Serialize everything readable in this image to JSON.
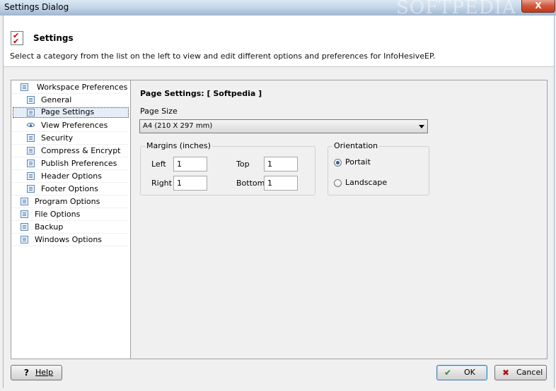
{
  "window": {
    "title": "Settings Dialog",
    "watermark": "SOFTPEDIA",
    "close_glyph": "X"
  },
  "header": {
    "title": "Settings",
    "description": "Select a category from the list on the left to view and edit different options and preferences for InfoHesiveEP."
  },
  "tree": {
    "items": [
      {
        "label": "Workspace Preferences"
      },
      {
        "label": "General"
      },
      {
        "label": "Page Settings"
      },
      {
        "label": "View Preferences"
      },
      {
        "label": "Security"
      },
      {
        "label": "Compress & Encrypt"
      },
      {
        "label": "Publish Preferences"
      },
      {
        "label": "Header Options"
      },
      {
        "label": "Footer Options"
      },
      {
        "label": "Program Options"
      },
      {
        "label": "File Options"
      },
      {
        "label": "Backup"
      },
      {
        "label": "Windows Options"
      }
    ],
    "selected": "Page Settings"
  },
  "panel": {
    "title": "Page Settings:  [ Softpedia ]",
    "page_size_label": "Page Size",
    "page_size_value": "A4 (210 X 297 mm)",
    "margins": {
      "title": "Margins (inches)",
      "left_label": "Left",
      "left_value": "1",
      "top_label": "Top",
      "top_value": "1",
      "right_label": "Right",
      "right_value": "1",
      "bottom_label": "Bottom",
      "bottom_value": "1"
    },
    "orientation": {
      "title": "Orientation",
      "portrait_label": "Portait",
      "landscape_label": "Landscape",
      "selected": "Portait"
    }
  },
  "buttons": {
    "help": "Help",
    "help_icon": "?",
    "ok": "OK",
    "ok_icon": "✔",
    "cancel": "Cancel",
    "cancel_icon": "✖"
  },
  "colors": {
    "accent": "#2f5f9c",
    "title_bar": "#c5d7ea",
    "close": "#c23a1f",
    "ok_icon": "#2e8b2e",
    "cancel_icon": "#b01010"
  }
}
